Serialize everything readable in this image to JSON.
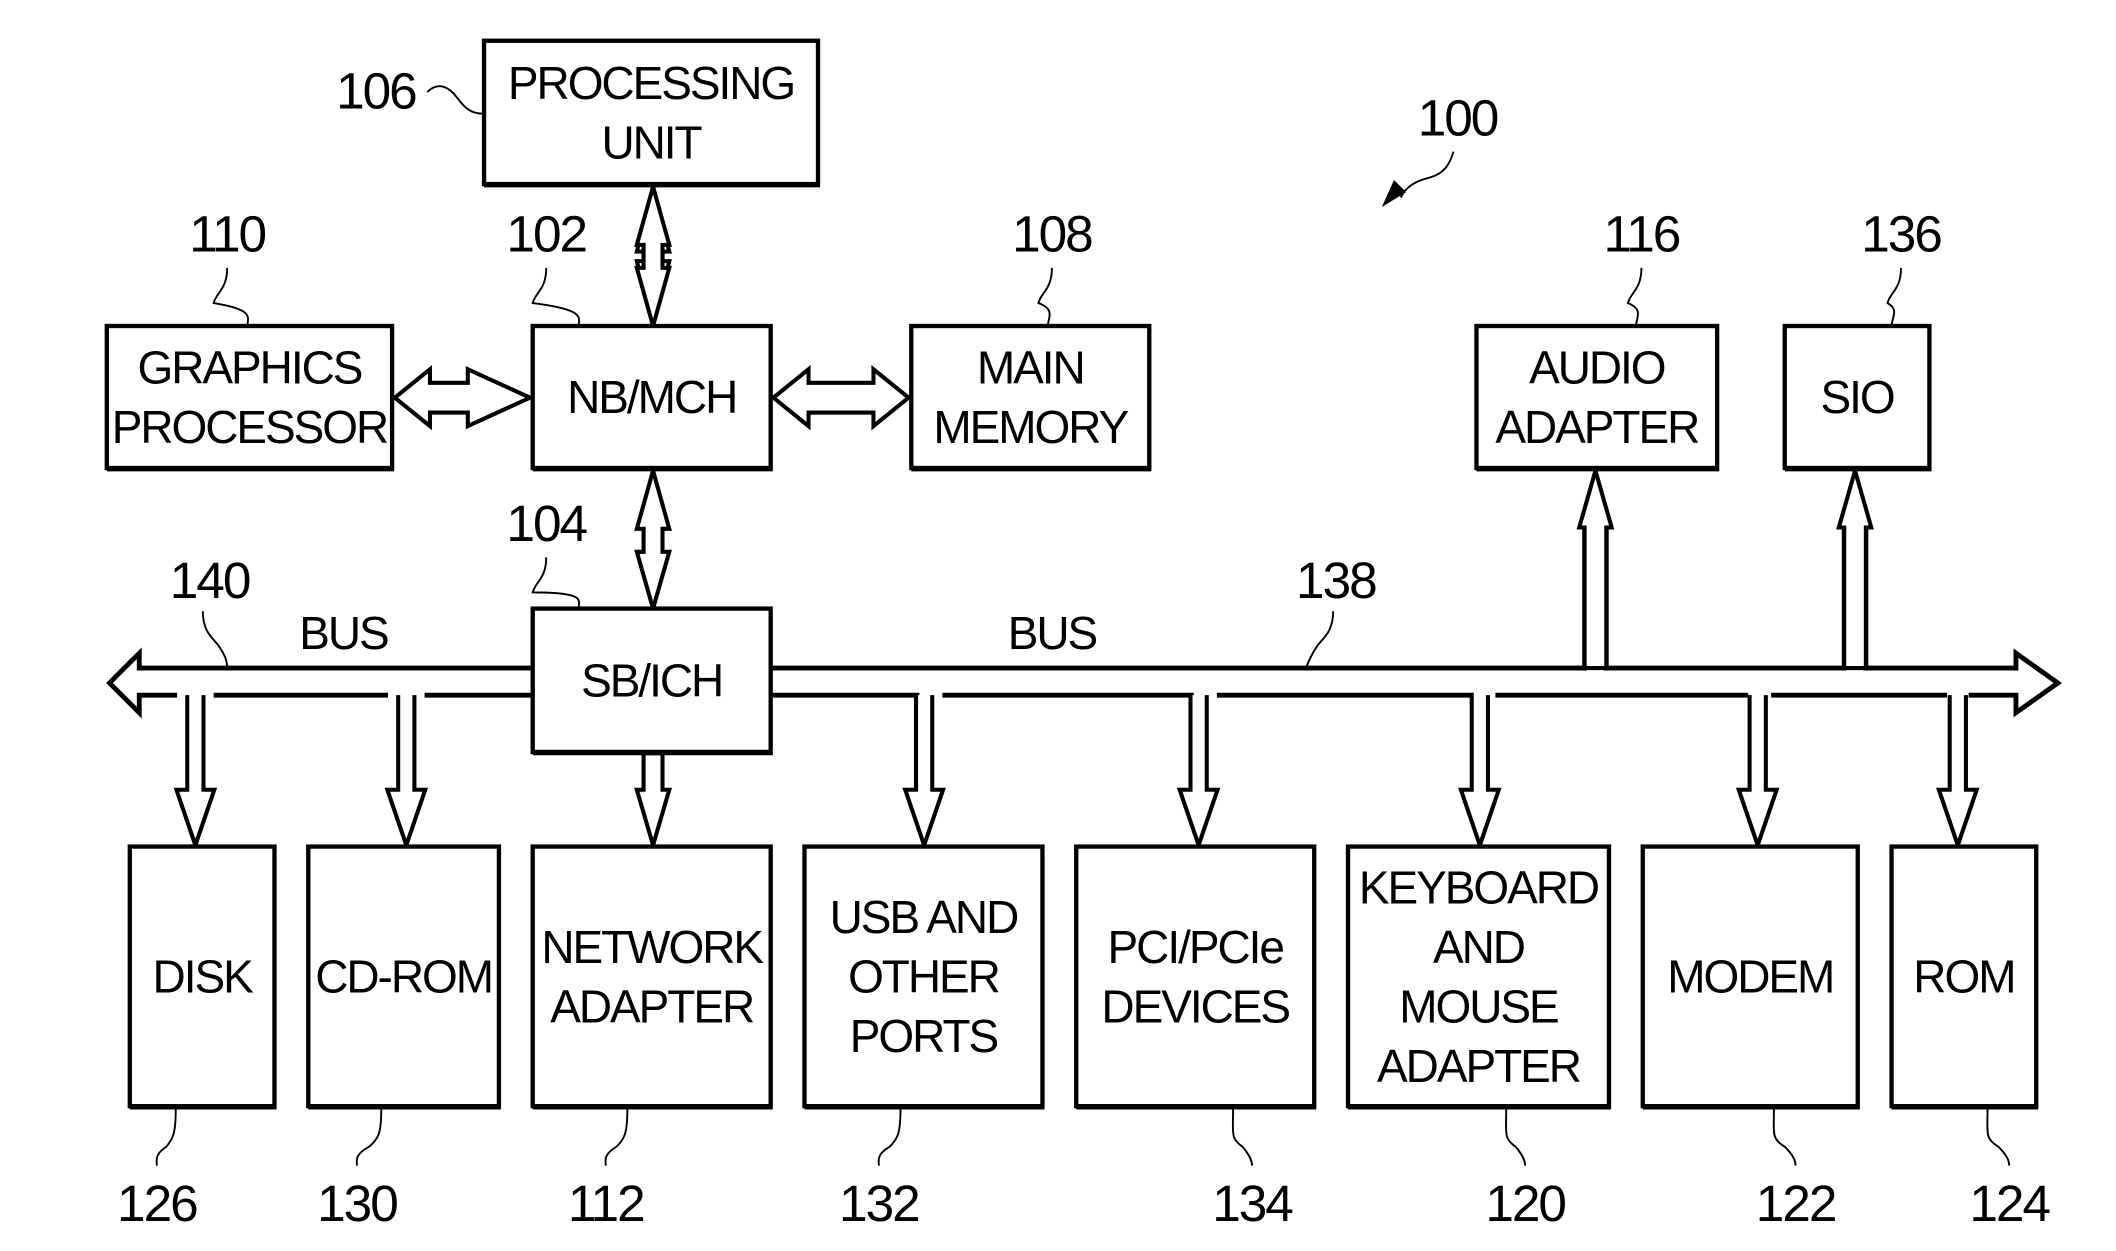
{
  "figure": {
    "reference": "100",
    "blocks": {
      "processing_unit": {
        "ref": "106",
        "lines": [
          "PROCESSING",
          "UNIT"
        ]
      },
      "graphics_processor": {
        "ref": "110",
        "lines": [
          "GRAPHICS",
          "PROCESSOR"
        ]
      },
      "nb_mch": {
        "ref": "102",
        "lines": [
          "NB/MCH"
        ]
      },
      "main_memory": {
        "ref": "108",
        "lines": [
          "MAIN",
          "MEMORY"
        ]
      },
      "audio_adapter": {
        "ref": "116",
        "lines": [
          "AUDIO",
          "ADAPTER"
        ]
      },
      "sio": {
        "ref": "136",
        "lines": [
          "SIO"
        ]
      },
      "sb_ich": {
        "ref": "104",
        "lines": [
          "SB/ICH"
        ]
      },
      "disk": {
        "ref": "126",
        "lines": [
          "DISK"
        ]
      },
      "cd_rom": {
        "ref": "130",
        "lines": [
          "CD-ROM"
        ]
      },
      "network_adapter": {
        "ref": "112",
        "lines": [
          "NETWORK",
          "ADAPTER"
        ]
      },
      "usb_ports": {
        "ref": "132",
        "lines": [
          "USB AND",
          "OTHER",
          "PORTS"
        ]
      },
      "pci_devices": {
        "ref": "134",
        "lines": [
          "PCI/PCIe",
          "DEVICES"
        ]
      },
      "keyboard_mouse": {
        "ref": "120",
        "lines": [
          "KEYBOARD",
          "AND",
          "MOUSE",
          "ADAPTER"
        ]
      },
      "modem": {
        "ref": "122",
        "lines": [
          "MODEM"
        ]
      },
      "rom": {
        "ref": "124",
        "lines": [
          "ROM"
        ]
      }
    },
    "buses": {
      "left": {
        "ref": "140",
        "label": "BUS"
      },
      "right": {
        "ref": "138",
        "label": "BUS"
      }
    }
  }
}
